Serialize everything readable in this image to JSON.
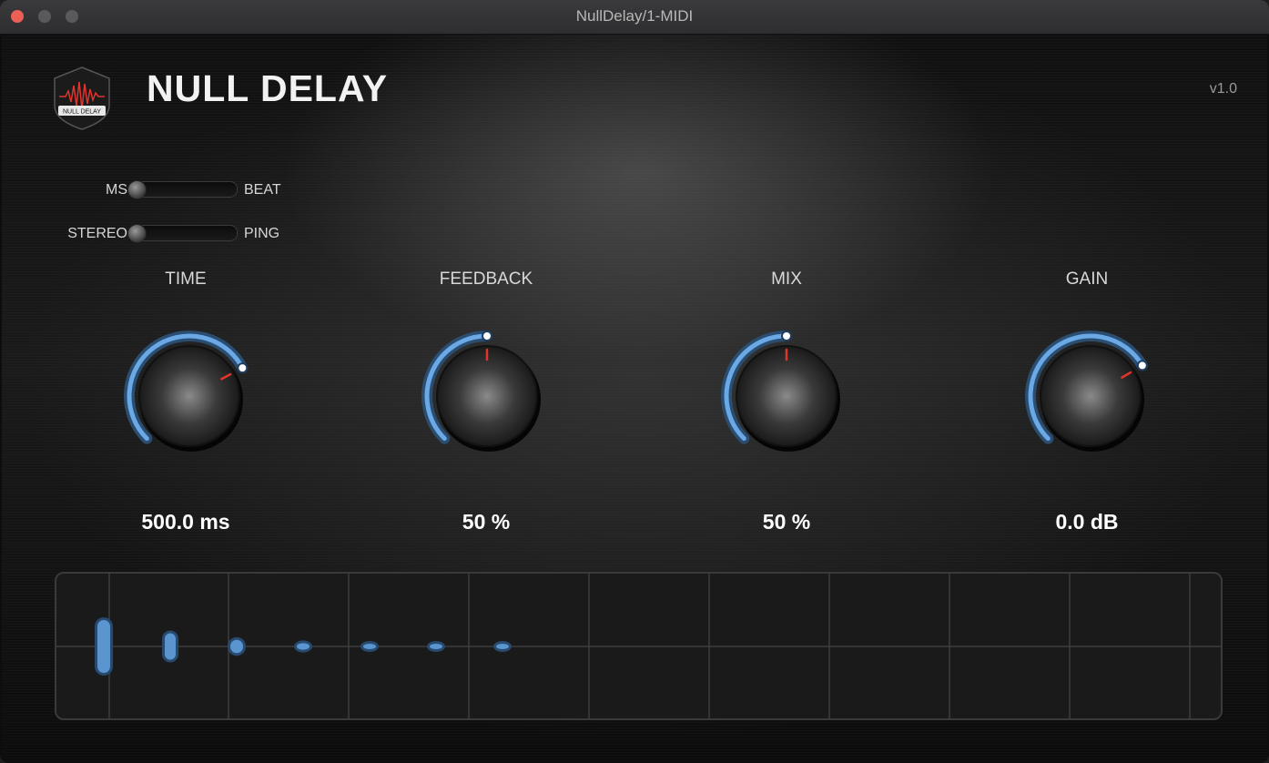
{
  "window": {
    "title": "NullDelay/1-MIDI"
  },
  "header": {
    "logo_text": "NULL DELAY",
    "brand": "NULL DELAY",
    "version": "v1.0"
  },
  "switches": [
    {
      "left_label": "MS",
      "right_label": "BEAT",
      "value": 0
    },
    {
      "left_label": "STEREO",
      "right_label": "PING",
      "value": 0
    }
  ],
  "knobs": [
    {
      "label": "TIME",
      "value_text": "500.0 ms",
      "position": 0.73
    },
    {
      "label": "FEEDBACK",
      "value_text": "50 %",
      "position": 0.5
    },
    {
      "label": "MIX",
      "value_text": "50 %",
      "position": 0.5
    },
    {
      "label": "GAIN",
      "value_text": "0.0 dB",
      "position": 0.72
    }
  ],
  "colors": {
    "accent": "#6aa8e6",
    "indicator": "#e0342c",
    "display_bg": "#1a1a1a"
  },
  "display": {
    "taps": [
      1.0,
      0.5,
      0.25,
      0.125,
      0.0625,
      0.031,
      0.016
    ]
  }
}
